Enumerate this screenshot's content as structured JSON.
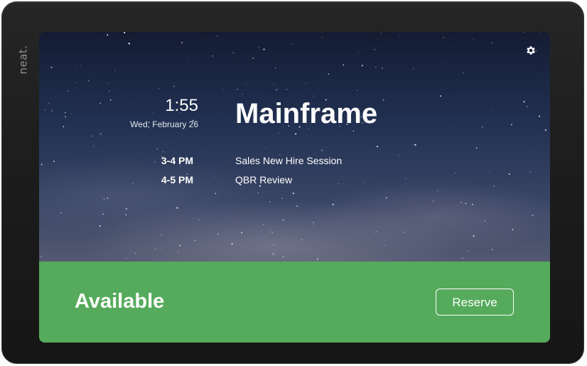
{
  "device": {
    "brand": "neat.",
    "frame_color": "#1d1d1d"
  },
  "header": {
    "settings_icon": "gear-icon"
  },
  "clock": {
    "time": "1:55",
    "date": "Wed, February 26"
  },
  "room": {
    "name": "Mainframe"
  },
  "schedule": {
    "meetings": [
      {
        "time": "3-4 PM",
        "title": "Sales New Hire Session"
      },
      {
        "time": "4-5 PM",
        "title": "QBR Review"
      }
    ]
  },
  "status": {
    "label": "Available",
    "color": "#56aa5c",
    "reserve_label": "Reserve"
  }
}
